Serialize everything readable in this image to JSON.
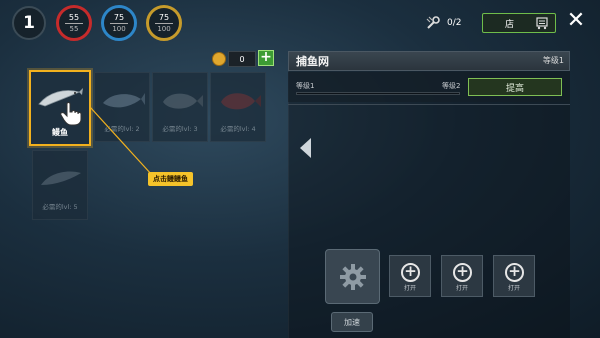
{
  "hud": {
    "level": "1",
    "stats": [
      {
        "name": "health",
        "value": "55",
        "max": "55",
        "color": "#c62b2b"
      },
      {
        "name": "energy",
        "value": "75",
        "max": "100",
        "color": "#2d86c8"
      },
      {
        "name": "food",
        "value": "75",
        "max": "100",
        "color": "#c69b2b"
      }
    ],
    "tool_count": "0/2",
    "shop_label": "店",
    "close_symbol": "✕"
  },
  "currency": {
    "value": "0",
    "add_symbol": "+"
  },
  "fish": [
    {
      "name": "鳗鱼",
      "requirement": "",
      "selected": true,
      "color": "#cfd6da"
    },
    {
      "name": "",
      "requirement": "必需的lvl: 2",
      "selected": false,
      "color": "#7f95a8"
    },
    {
      "name": "",
      "requirement": "必需的lvl: 3",
      "selected": false,
      "color": "#6c7a84"
    },
    {
      "name": "",
      "requirement": "必需的lvl: 4",
      "selected": false,
      "color": "#8a3232"
    },
    {
      "name": "",
      "requirement": "必需的lvl: 5",
      "selected": false,
      "color": "#6e7f8c"
    }
  ],
  "hint": "点击鳗鳗鱼",
  "panel": {
    "title": "捕鱼网",
    "level_label": "等级1",
    "level_from": "等级1",
    "level_to": "等级2",
    "upgrade_progress": 0.0,
    "upgrade_button": "提高",
    "speed_button": "加速",
    "slot_labels": [
      "打开",
      "打开",
      "打开"
    ]
  },
  "colors": {
    "accent": "#f2b11e",
    "green": "#6fbd4a"
  }
}
